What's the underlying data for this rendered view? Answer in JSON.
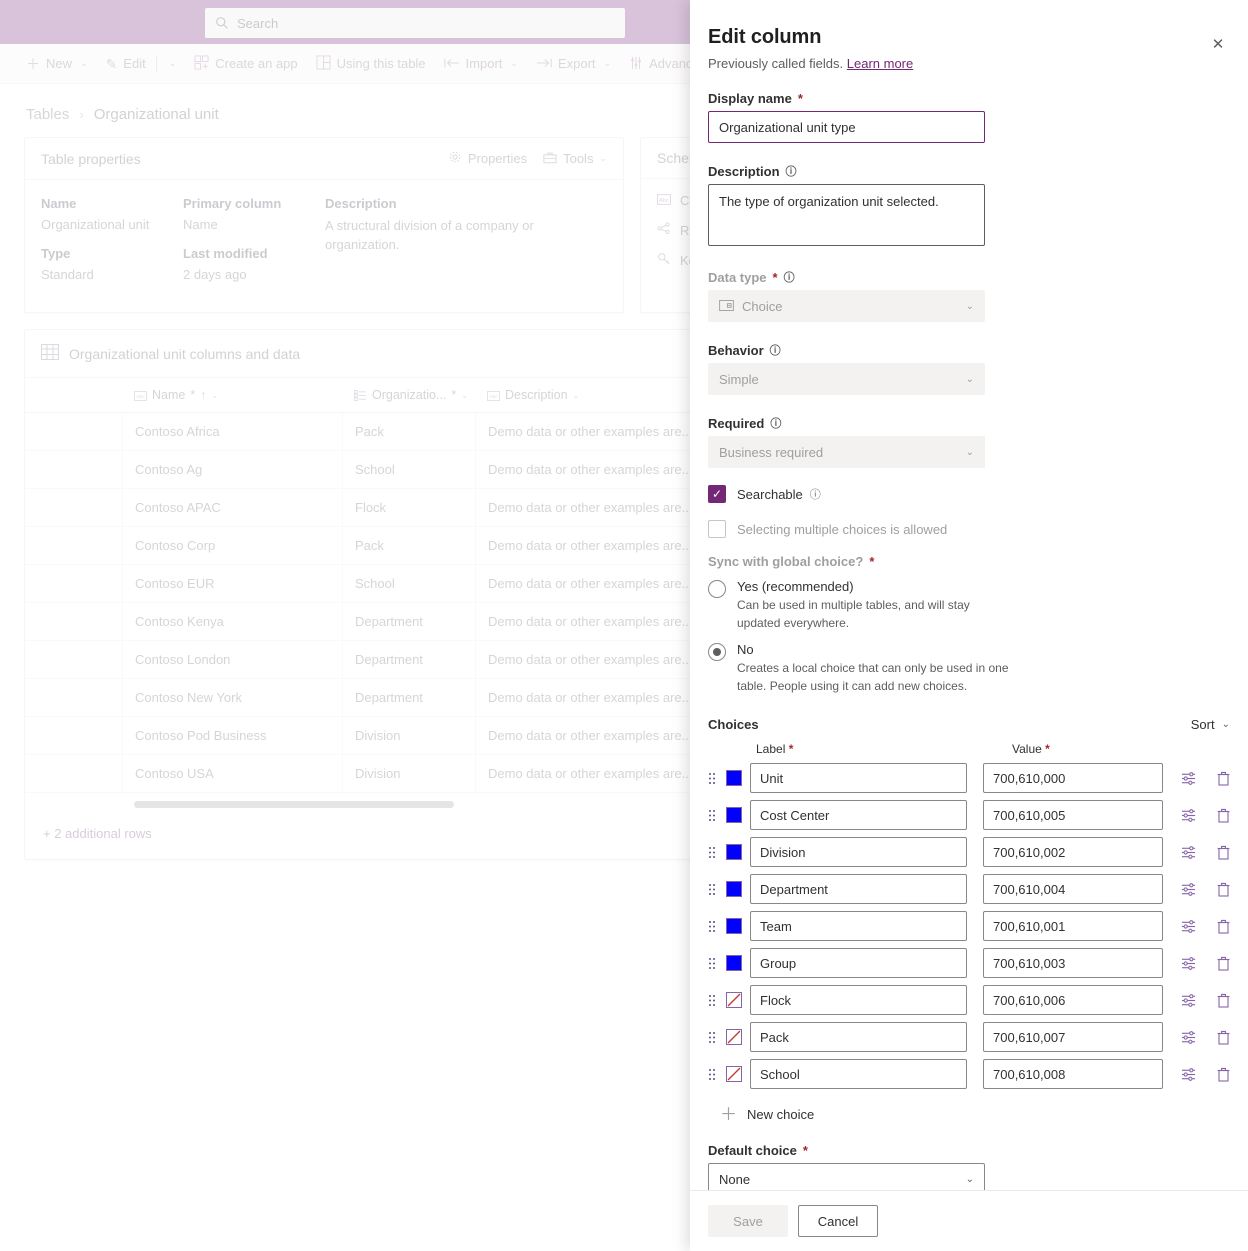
{
  "header": {
    "search_placeholder": "Search",
    "search_icon": "search-icon",
    "bar_color": "#a97bae"
  },
  "command_bar": {
    "items": [
      {
        "label": "New",
        "icon": "plus-icon",
        "has_chevron": true
      },
      {
        "label": "Edit",
        "icon": "pencil-icon",
        "has_chevron": true,
        "separator_before_chevron": true
      },
      {
        "label": "Create an app",
        "icon": "app-grid-icon",
        "has_chevron": false
      },
      {
        "label": "Using this table",
        "icon": "table-layout-icon",
        "has_chevron": false
      },
      {
        "label": "Import",
        "icon": "import-arrow-icon",
        "has_chevron": true
      },
      {
        "label": "Export",
        "icon": "export-arrow-icon",
        "has_chevron": true
      },
      {
        "label": "Advanced",
        "icon": "sliders-icon",
        "has_chevron": true
      }
    ]
  },
  "breadcrumb": {
    "root": "Tables",
    "separator": "›",
    "current": "Organizational unit"
  },
  "table_properties": {
    "title": "Table properties",
    "actions": [
      {
        "label": "Properties",
        "icon": "gear-icon"
      },
      {
        "label": "Tools",
        "icon": "toolbox-icon",
        "has_chevron": true
      }
    ],
    "fields": [
      {
        "label": "Name",
        "value": "Organizational unit"
      },
      {
        "label": "Type",
        "value": "Standard"
      },
      {
        "label": "Primary column",
        "value": "Name"
      },
      {
        "label": "Last modified",
        "value": "2 days ago"
      }
    ],
    "description_label": "Description",
    "description_value": "A structural division of a company or organization."
  },
  "schema_card": {
    "title": "Schema",
    "items": [
      {
        "label": "Columns",
        "icon": "abc-text-icon"
      },
      {
        "label": "Relationships",
        "icon": "share-nodes-icon"
      },
      {
        "label": "Keys",
        "icon": "key-icon"
      }
    ]
  },
  "data_grid": {
    "title": "Organizational unit columns and data",
    "title_icon": "table-grid-icon",
    "columns": [
      {
        "label": "Name",
        "icon": "abc-text-icon",
        "required": true,
        "sorted_asc": true,
        "has_chevron": true
      },
      {
        "label": "Organizatio...",
        "icon": "choice-list-icon",
        "required": true,
        "sorted_asc": false,
        "has_chevron": true
      },
      {
        "label": "Description",
        "icon": "abc-text-icon",
        "required": false,
        "sorted_asc": false,
        "has_chevron": true
      }
    ],
    "rows": [
      {
        "name": "Contoso Africa",
        "type": "Pack",
        "description": "Demo data or other examples are..."
      },
      {
        "name": "Contoso Ag",
        "type": "School",
        "description": "Demo data or other examples are..."
      },
      {
        "name": "Contoso APAC",
        "type": "Flock",
        "description": "Demo data or other examples are..."
      },
      {
        "name": "Contoso Corp",
        "type": "Pack",
        "description": "Demo data or other examples are..."
      },
      {
        "name": "Contoso EUR",
        "type": "School",
        "description": "Demo data or other examples are..."
      },
      {
        "name": "Contoso Kenya",
        "type": "Department",
        "description": "Demo data or other examples are..."
      },
      {
        "name": "Contoso London",
        "type": "Department",
        "description": "Demo data or other examples are..."
      },
      {
        "name": "Contoso New York",
        "type": "Department",
        "description": "Demo data or other examples are..."
      },
      {
        "name": "Contoso Pod Business",
        "type": "Division",
        "description": "Demo data or other examples are..."
      },
      {
        "name": "Contoso USA",
        "type": "Division",
        "description": "Demo data or other examples are..."
      }
    ],
    "additional_rows_label": "+ 2 additional rows"
  },
  "panel": {
    "title": "Edit column",
    "subtitle_text": "Previously called fields.",
    "subtitle_link": "Learn more",
    "close_icon": "close-icon",
    "display_name": {
      "label": "Display name",
      "required": true,
      "value": "Organizational unit type"
    },
    "description": {
      "label": "Description",
      "info_icon": "info-icon",
      "value": "The type of organization unit selected."
    },
    "data_type": {
      "label": "Data type",
      "required": true,
      "info_icon": "info-icon",
      "value": "Choice",
      "icon": "choice-field-icon",
      "disabled": true
    },
    "behavior": {
      "label": "Behavior",
      "info_icon": "info-icon",
      "value": "Simple",
      "disabled": true
    },
    "required_field": {
      "label": "Required",
      "info_icon": "info-icon",
      "value": "Business required",
      "disabled": true
    },
    "searchable": {
      "label": "Searchable",
      "checked": true,
      "info_icon": "info-icon",
      "check_color": "#742774"
    },
    "multiple_choices": {
      "label": "Selecting multiple choices is allowed",
      "checked": false,
      "disabled": true
    },
    "sync_global": {
      "label": "Sync with global choice?",
      "required": true,
      "options": [
        {
          "label": "Yes (recommended)",
          "description": "Can be used in multiple tables, and will stay updated everywhere.",
          "selected": false
        },
        {
          "label": "No",
          "description": "Creates a local choice that can only be used in one table. People using it can add new choices.",
          "selected": true
        }
      ]
    },
    "choices": {
      "title": "Choices",
      "sort_label": "Sort",
      "col_label_header": "Label",
      "col_value_header": "Value",
      "row_edit_icon": "sliders-icon",
      "row_delete_icon": "trash-icon",
      "drag_icon": "drag-handle-icon",
      "items": [
        {
          "label": "Unit",
          "value": "700,610,000",
          "color": "#0000FF",
          "has_color": true
        },
        {
          "label": "Cost Center",
          "value": "700,610,005",
          "color": "#0000FF",
          "has_color": true
        },
        {
          "label": "Division",
          "value": "700,610,002",
          "color": "#0000FF",
          "has_color": true
        },
        {
          "label": "Department",
          "value": "700,610,004",
          "color": "#0000FF",
          "has_color": true
        },
        {
          "label": "Team",
          "value": "700,610,001",
          "color": "#0000FF",
          "has_color": true
        },
        {
          "label": "Group",
          "value": "700,610,003",
          "color": "#0000FF",
          "has_color": true
        },
        {
          "label": "Flock",
          "value": "700,610,006",
          "color": "",
          "has_color": false
        },
        {
          "label": "Pack",
          "value": "700,610,007",
          "color": "",
          "has_color": false
        },
        {
          "label": "School",
          "value": "700,610,008",
          "color": "",
          "has_color": false
        }
      ],
      "new_choice_label": "New choice",
      "new_choice_icon": "plus-icon"
    },
    "default_choice": {
      "label": "Default choice",
      "required": true,
      "value": "None"
    },
    "footer": {
      "save_label": "Save",
      "save_disabled": true,
      "cancel_label": "Cancel"
    }
  }
}
